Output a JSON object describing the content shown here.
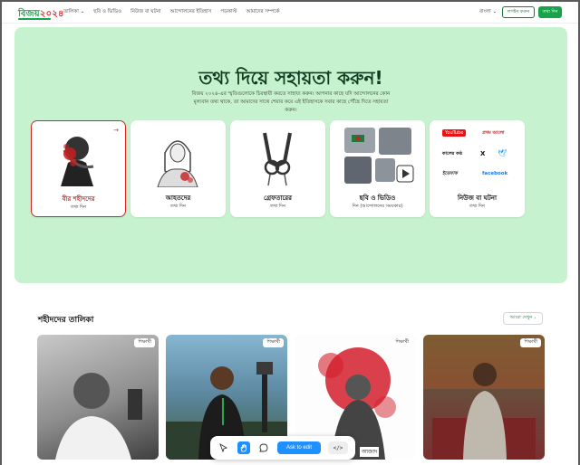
{
  "nav": {
    "logo": {
      "a": "বিজয়",
      "b": "২০২৪"
    },
    "menu": [
      "তালিকা",
      "ছবি ও ভিডিও",
      "নিউজ বা ঘটনা",
      "আন্দোলনের ইতিহাস",
      "পডকাস্ট",
      "আমাদের সম্পর্কে"
    ],
    "language": "বাংলা",
    "login_label": "লগইন করুন",
    "cta_label": "তথ্য দিন"
  },
  "hero": {
    "title": "তথ্য দিয়ে সহায়তা করুন!",
    "description": "বিজয় ২০২৪-এর স্মৃতিগুলোকে চিরস্থায়ী করতে সাহায্য করুন। আপনার কাছে যদি আন্দোলনের কোন মূল্যবান তথ্য থাকে, তা আমাদের সাথে শেয়ার করে এই ইতিহাসকে সবার কাছে পৌঁছে দিতে সহায়তা করুন।",
    "cards": [
      {
        "title": "বীর শহীদদের",
        "sub": "তথ্য দিন"
      },
      {
        "title": "আহতদের",
        "sub": "তথ্য দিন"
      },
      {
        "title": "গ্রেফতারের",
        "sub": "তথ্য দিন"
      },
      {
        "title": "ছবি ও ভিডিও",
        "sub": "দিন (আন্দোলনের সময়কার)"
      },
      {
        "title": "নিউজ বা ঘটনা",
        "sub": "তথ্য দিন"
      }
    ],
    "news_logos": [
      "YouTube",
      "প্রথম আলো",
      "কালের কণ্ঠ",
      "X",
      "ইত্তেফাক",
      "facebook"
    ]
  },
  "list": {
    "title": "শহীদদের তালিকা",
    "see_more": "আরো দেখুন",
    "tag": "শিক্ষার্থী",
    "photo_caption": "আজাদ"
  },
  "toolbar": {
    "ask_label": "Ask to edit",
    "code_label": "</>"
  }
}
